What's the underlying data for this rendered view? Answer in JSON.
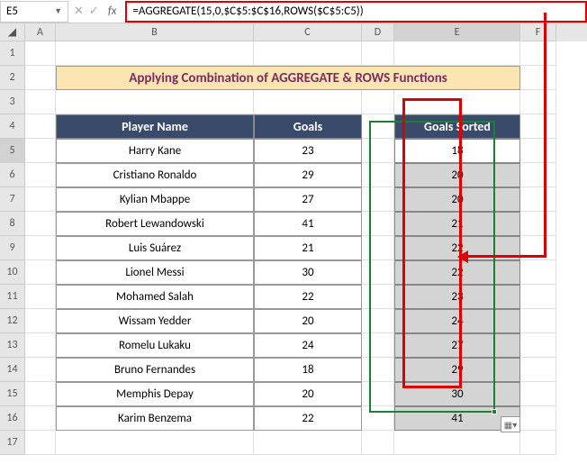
{
  "nameBox": "E5",
  "formulaBar": "=AGGREGATE(15,0,$C$5:$C$16,ROWS($C$5:C5))",
  "columns": [
    "A",
    "B",
    "C",
    "D",
    "E",
    "F"
  ],
  "rows": [
    "1",
    "2",
    "3",
    "4",
    "5",
    "6",
    "7",
    "8",
    "9",
    "10",
    "11",
    "12",
    "13",
    "14",
    "15",
    "16",
    "17"
  ],
  "activeColumn": "E",
  "activeRow": "5",
  "title": "Applying Combination of AGGREGATE & ROWS Functions",
  "headers": {
    "player": "Player Name",
    "goals": "Goals",
    "sorted": "Goals Sorted"
  },
  "chart_data": {
    "type": "table",
    "title": "Applying Combination of AGGREGATE & ROWS Functions",
    "columns": [
      "Player Name",
      "Goals",
      "Goals Sorted"
    ],
    "rows": [
      [
        "Harry Kane",
        23,
        18
      ],
      [
        "Cristiano Ronaldo",
        29,
        20
      ],
      [
        "Kylian Mbappe",
        27,
        20
      ],
      [
        "Robert Lewandowski",
        41,
        21
      ],
      [
        "Luis Suárez",
        21,
        22
      ],
      [
        "Lionel Messi",
        30,
        22
      ],
      [
        "Mohamed Salah",
        22,
        23
      ],
      [
        "Wissam Yedder",
        20,
        24
      ],
      [
        "Romelu Lukaku",
        24,
        27
      ],
      [
        "Bruno Fernandes",
        18,
        29
      ],
      [
        "Memphis Depay",
        20,
        30
      ],
      [
        "Karim Benzema",
        22,
        41
      ]
    ]
  }
}
